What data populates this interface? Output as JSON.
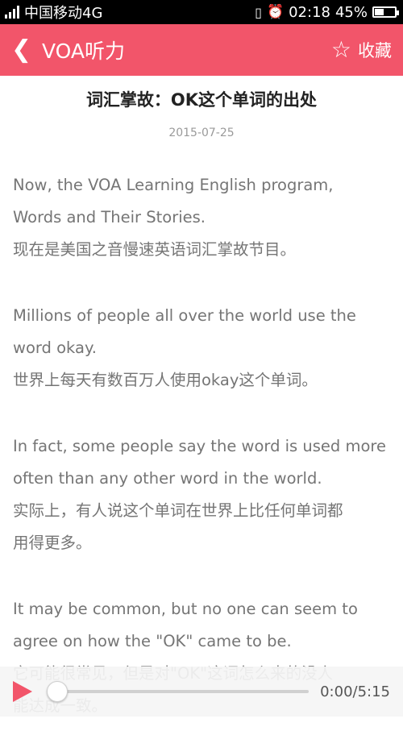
{
  "status_bar": {
    "carrier": "中国移动4G",
    "time": "02:18",
    "battery_text": "45%",
    "battery_level": 0.45
  },
  "header": {
    "title": "VOA听力",
    "favorite_label": "收藏"
  },
  "article": {
    "title": "词汇掌故：OK这个单词的出处",
    "date": "2015-07-25",
    "paragraphs": [
      {
        "en": [
          "Now, the VOA Learning English program,",
          "Words and Their Stories."
        ],
        "zh": [
          "现在是美国之音慢速英语词汇掌故节目。"
        ]
      },
      {
        "en": [
          "Millions of people all over the world use the",
          "word okay."
        ],
        "zh": [
          "世界上每天有数百万人使用okay这个单词。"
        ]
      },
      {
        "en": [
          "In fact, some people say the word is used more",
          "often than any other word in the world."
        ],
        "zh": [
          "实际上，有人说这个单词在世界上比任何单词都",
          "用得更多。"
        ]
      },
      {
        "en": [
          "It may be common, but no one can seem to",
          "agree on how the \"OK\" came to be."
        ],
        "zh": [
          "它可能很常见，但是对\"OK\"这词怎么来的没人",
          "能达成一致。"
        ]
      }
    ]
  },
  "player": {
    "time": "0:00/5:15",
    "progress": 0.0
  },
  "colors": {
    "accent": "#f2556a",
    "status_bar": "#000000",
    "body_text": "#757575"
  }
}
